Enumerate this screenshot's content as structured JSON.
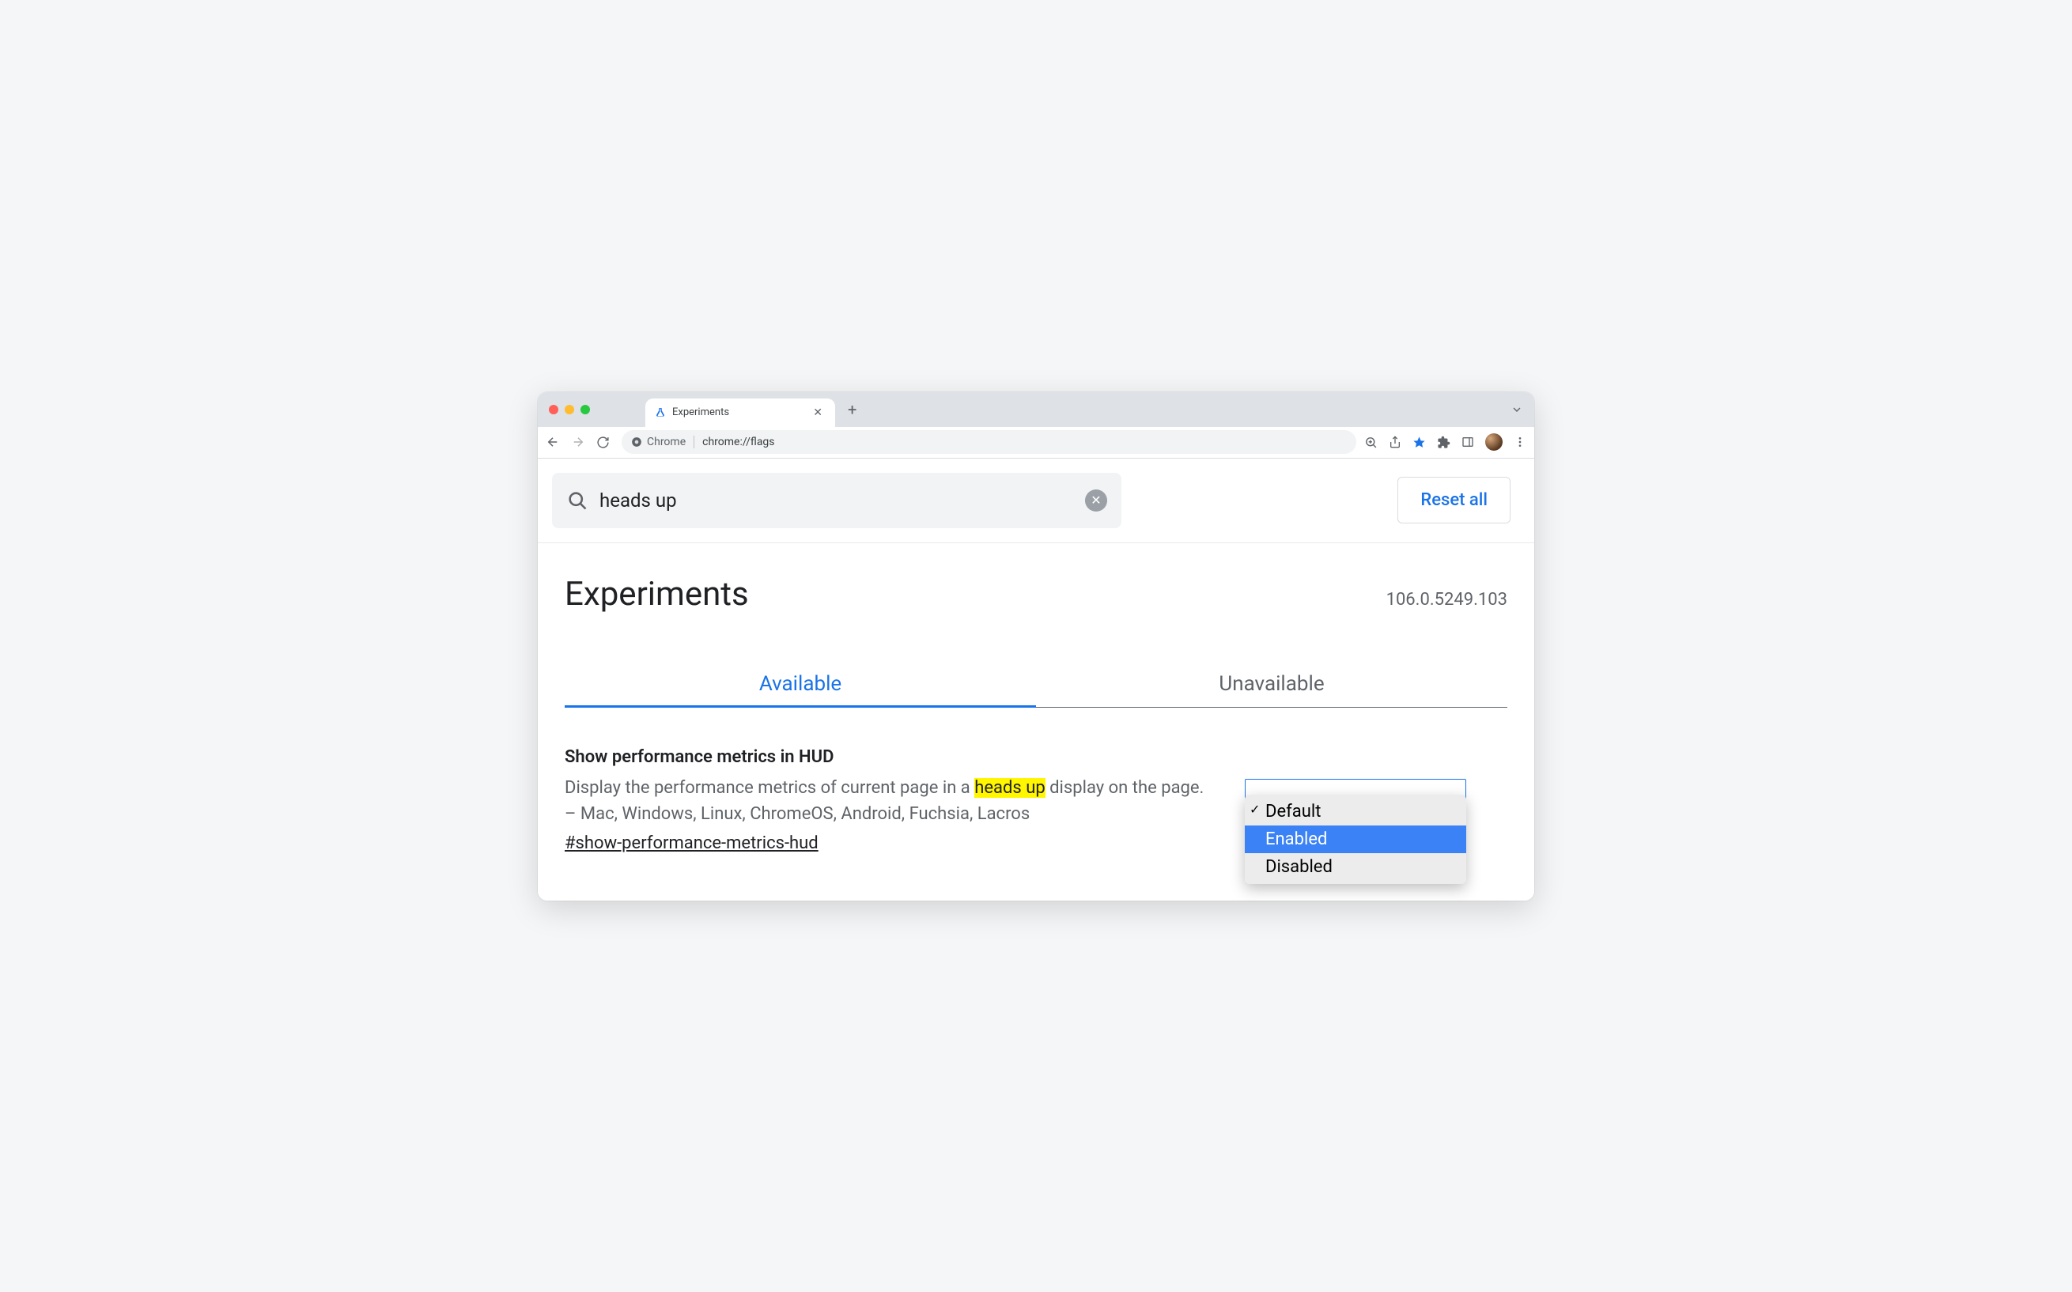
{
  "browser": {
    "tab_title": "Experiments",
    "omnibox_chip": "Chrome",
    "omnibox_url": "chrome://flags"
  },
  "search": {
    "value": "heads up",
    "reset_label": "Reset all"
  },
  "header": {
    "title": "Experiments",
    "version": "106.0.5249.103"
  },
  "tabs": {
    "available": "Available",
    "unavailable": "Unavailable"
  },
  "flag": {
    "title": "Show performance metrics in HUD",
    "desc_before": "Display the performance metrics of current page in a ",
    "desc_highlight": "heads up",
    "desc_after": " display on the page. – Mac, Windows, Linux, ChromeOS, Android, Fuchsia, Lacros",
    "link": "#show-performance-metrics-hud",
    "options": {
      "default": "Default",
      "enabled": "Enabled",
      "disabled": "Disabled"
    }
  }
}
